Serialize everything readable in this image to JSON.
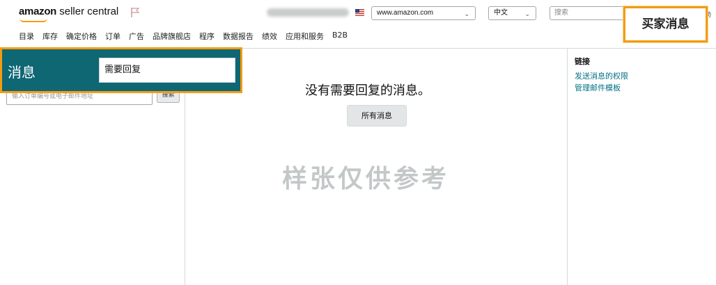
{
  "header": {
    "logo_brand": "amazon",
    "logo_product": "seller central",
    "marketplace": "www.amazon.com",
    "language": "中文",
    "search_placeholder": "搜索",
    "help_glyph": "助"
  },
  "nav": {
    "items": [
      "目录",
      "库存",
      "确定价格",
      "订单",
      "广告",
      "品牌旗舰店",
      "程序",
      "数据报告",
      "绩效",
      "应用和服务",
      "B2B"
    ]
  },
  "callouts": {
    "buyer_messages": "买家消息"
  },
  "left": {
    "title": "消息",
    "filter_value": "需要回复",
    "order_search_placeholder": "输入订单编号或电子邮件地址",
    "search_button": "搜索"
  },
  "main": {
    "empty_message": "没有需要回复的消息。",
    "all_messages_button": "所有消息",
    "watermark": "样张仅供参考"
  },
  "right": {
    "links_title": "链接",
    "links": [
      "发送消息的权限",
      "管理邮件模板"
    ]
  },
  "colors": {
    "accent_orange": "#f39c12",
    "banner_teal": "#0f6774",
    "link_teal": "#007185"
  }
}
